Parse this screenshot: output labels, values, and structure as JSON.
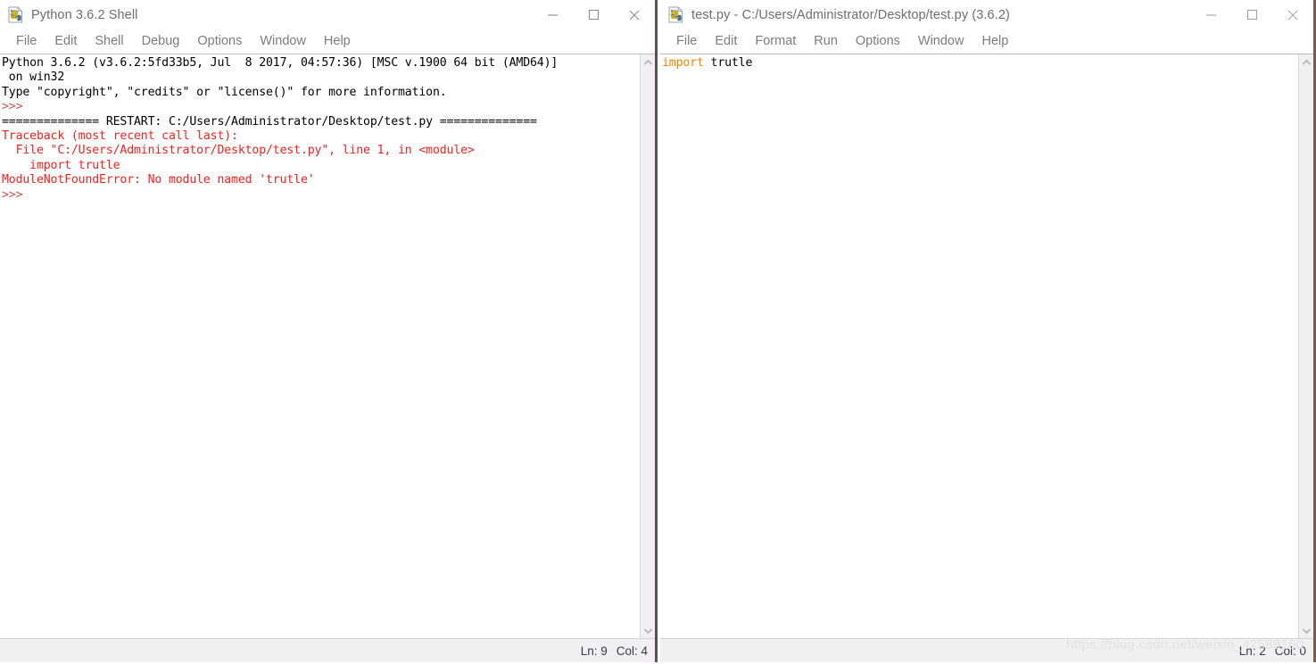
{
  "shell_window": {
    "title": "Python 3.6.2 Shell",
    "icon": "python-idle-icon",
    "menus": [
      "File",
      "Edit",
      "Shell",
      "Debug",
      "Options",
      "Window",
      "Help"
    ],
    "window_controls": {
      "minimize": "minimize-icon",
      "maximize": "maximize-icon",
      "close": "close-icon"
    },
    "output_lines": [
      [
        {
          "text": "Python 3.6.2 (v3.6.2:5fd33b5, Jul  8 2017, 04:57:36) [MSC v.1900 64 bit (AMD64)]",
          "style": "plain"
        }
      ],
      [
        {
          "text": " on win32",
          "style": "plain"
        }
      ],
      [
        {
          "text": "Type \"copyright\", \"credits\" or \"license()\" for more information.",
          "style": "plain"
        }
      ],
      [
        {
          "text": ">>>",
          "style": "prompt"
        }
      ],
      [
        {
          "text": "============== RESTART: C:/Users/Administrator/Desktop/test.py ==============",
          "style": "plain"
        }
      ],
      [
        {
          "text": "Traceback (most recent call last):",
          "style": "error"
        }
      ],
      [
        {
          "text": "  File \"C:/Users/Administrator/Desktop/test.py\", line 1, in <module>",
          "style": "error"
        }
      ],
      [
        {
          "text": "    import trutle",
          "style": "error"
        }
      ],
      [
        {
          "text": "ModuleNotFoundError: No module named 'trutle'",
          "style": "error"
        }
      ],
      [
        {
          "text": ">>>",
          "style": "prompt"
        }
      ]
    ],
    "scrollbar": {
      "up_arrow": "chevron-up-icon",
      "down_arrow": "chevron-down-icon"
    },
    "status": {
      "line_label": "Ln: 9",
      "col_label": "Col: 4"
    }
  },
  "editor_window": {
    "title": "test.py - C:/Users/Administrator/Desktop/test.py (3.6.2)",
    "icon": "python-idle-icon",
    "menus": [
      "File",
      "Edit",
      "Format",
      "Run",
      "Options",
      "Window",
      "Help"
    ],
    "window_controls": {
      "minimize": "minimize-icon",
      "maximize": "maximize-icon",
      "close": "close-icon"
    },
    "code_lines": [
      [
        {
          "text": "import",
          "style": "keyword"
        },
        {
          "text": " trutle",
          "style": "plain"
        }
      ],
      [
        {
          "text": "",
          "style": "plain"
        }
      ]
    ],
    "scrollbar": {
      "up_arrow": "chevron-up-icon",
      "down_arrow": "chevron-down-icon"
    },
    "status": {
      "line_label": "Ln: 2",
      "col_label": "Col: 0"
    }
  },
  "watermark": {
    "text": "https://blog.csdn.net/weixin_42588160"
  },
  "colors": {
    "error_red": "#ff1d1d",
    "prompt_red": "#d05050",
    "keyword_orange": "#ff8000",
    "title_gray": "#6d6d75",
    "menu_gray": "#7b7b82",
    "status_bg": "#f0f0f0"
  }
}
